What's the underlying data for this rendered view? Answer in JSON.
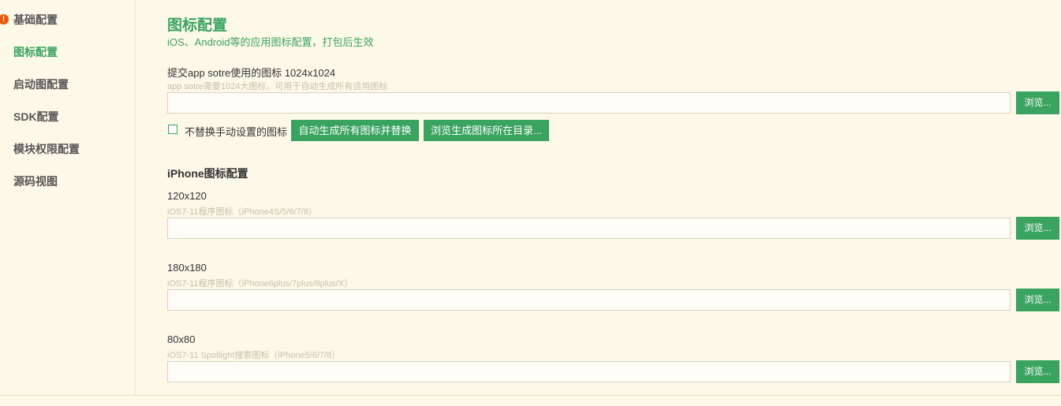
{
  "sidebar": {
    "items": [
      {
        "label": "基础配置",
        "warning": true
      },
      {
        "label": "图标配置",
        "active": true
      },
      {
        "label": "启动图配置"
      },
      {
        "label": "SDK配置"
      },
      {
        "label": "模块权限配置"
      },
      {
        "label": "源码视图"
      }
    ],
    "warning_glyph": "!"
  },
  "main": {
    "title": "图标配置",
    "subtitle": "iOS、Android等的应用图标配置，打包后生效",
    "appstore": {
      "label": "提交app sotre使用的图标 1024x1024",
      "hint": "app sotre需要1024大图标，可用于自动生成所有适用图标",
      "value": "",
      "browse_label": "浏览..."
    },
    "no_replace_label": "不替换手动设置的图标",
    "no_replace_checked": false,
    "auto_generate_label": "自动生成所有图标并替换",
    "browse_dir_label": "浏览生成图标所在目录...",
    "iphone_section": "iPhone图标配置",
    "icons": [
      {
        "label": "120x120",
        "hint": "iOS7-11程序图标（iPhone4S/5/6/7/8）",
        "value": "",
        "browse_label": "浏览..."
      },
      {
        "label": "180x180",
        "hint": "iOS7-11程序图标（iPhone6plus/7plus/8plus/X）",
        "value": "",
        "browse_label": "浏览..."
      },
      {
        "label": "80x80",
        "hint": "iOS7-11 Spotlight搜索图标（iPhone5/6/7/8）",
        "value": "",
        "browse_label": "浏览..."
      }
    ]
  },
  "colors": {
    "accent": "#3aa360",
    "background": "#fdf9e8",
    "warning": "#e8590c"
  }
}
